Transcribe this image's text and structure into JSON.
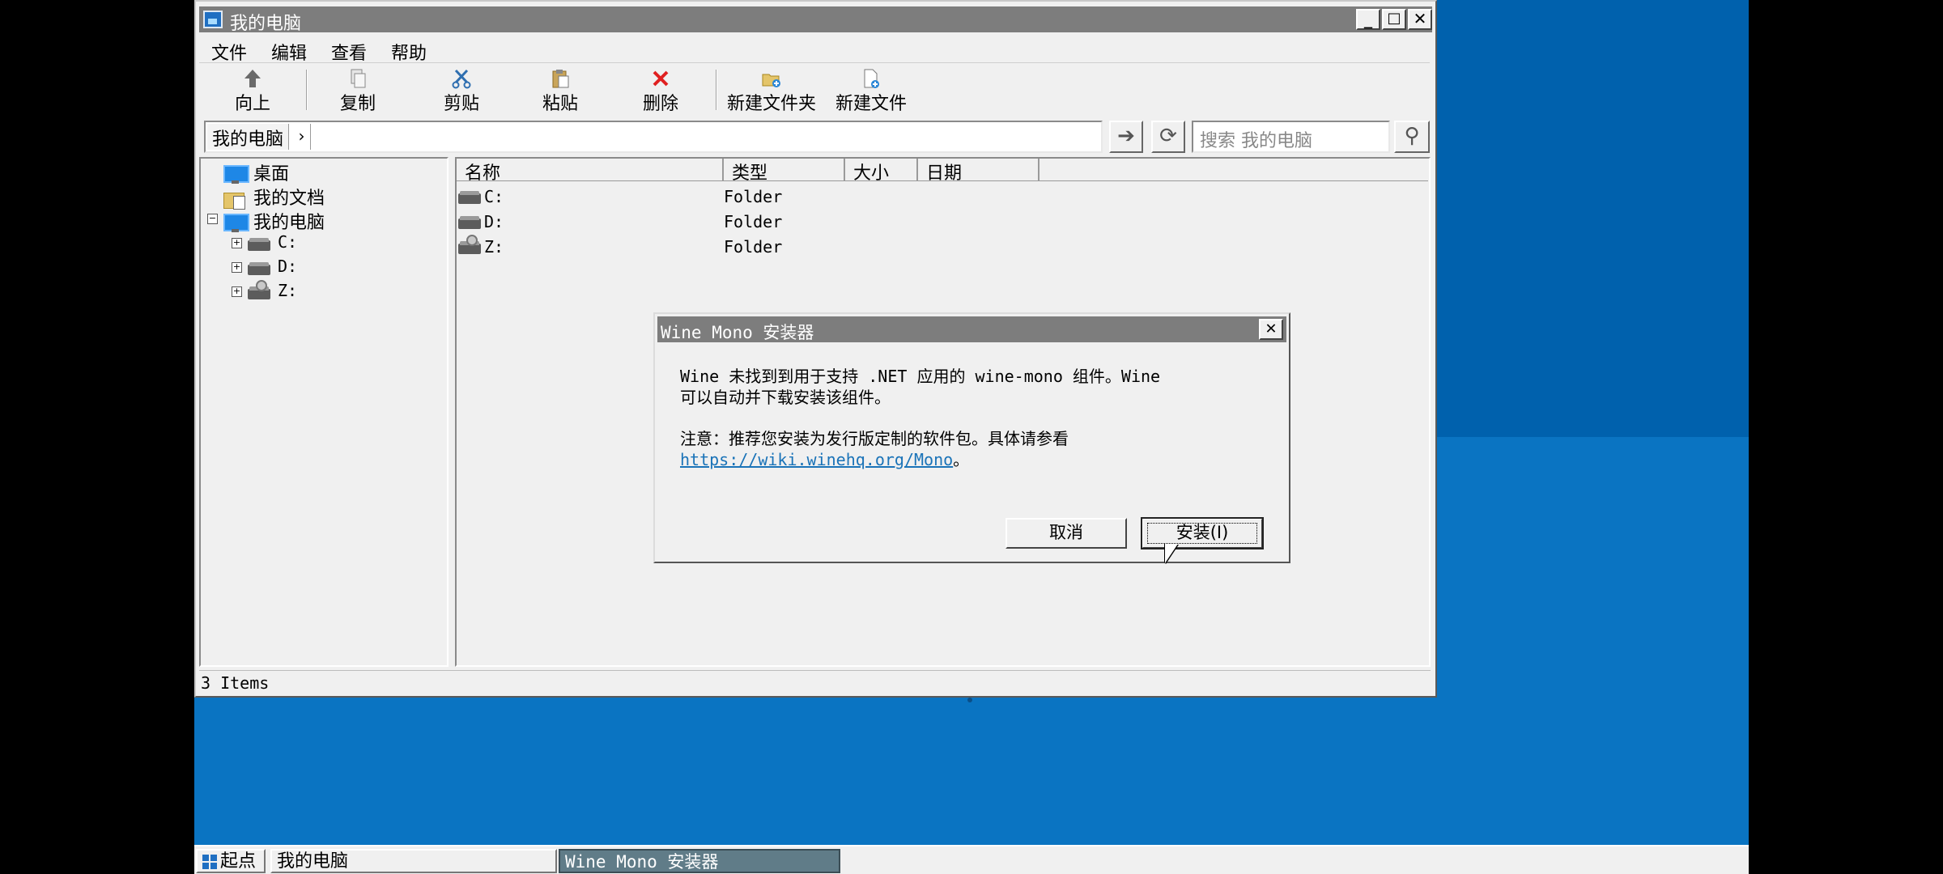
{
  "window": {
    "title": "我的电脑",
    "minimize": "_",
    "maximize": "□",
    "close": "✕"
  },
  "menu": [
    "文件",
    "编辑",
    "查看",
    "帮助"
  ],
  "toolbar": {
    "up": "向上",
    "copy": "复制",
    "cut": "剪贴",
    "paste": "粘贴",
    "delete": "删除",
    "new_folder": "新建文件夹",
    "new_file": "新建文件"
  },
  "address": {
    "crumb": "我的电脑",
    "crumb_arrow": "›",
    "go": "➔",
    "refresh": "⟳",
    "search_placeholder": "搜索 我的电脑",
    "search_icon": "⚲"
  },
  "tree": {
    "desktop": "桌面",
    "documents": "我的文档",
    "computer": "我的电脑",
    "drives": [
      "C:",
      "D:",
      "Z:"
    ]
  },
  "columns": [
    "名称",
    "类型",
    "大小",
    "日期"
  ],
  "rows": [
    {
      "name": "C:",
      "type": "Folder"
    },
    {
      "name": "D:",
      "type": "Folder"
    },
    {
      "name": "Z:",
      "type": "Folder"
    }
  ],
  "status": "3 Items",
  "dialog": {
    "title": "Wine Mono 安装器",
    "close": "✕",
    "line1": "Wine 未找到到用于支持 .NET 应用的 wine-mono 组件。Wine",
    "line2": "可以自动并下载安装该组件。",
    "line3": "注意：推荐您安装为发行版定制的软件包。具体请参看",
    "link": "https://wiki.winehq.org/Mono",
    "link_suffix": "。",
    "cancel": "取消",
    "install": "安装(I)"
  },
  "taskbar": {
    "start": "起点",
    "item1": "我的电脑",
    "item2": "Wine Mono 安装器"
  },
  "icons": {
    "up": "arrow-up-icon",
    "copy": "copy-icon",
    "cut": "scissors-icon",
    "paste": "paste-icon",
    "delete": "delete-x-icon",
    "new_folder": "new-folder-icon",
    "new_file": "new-file-icon"
  }
}
